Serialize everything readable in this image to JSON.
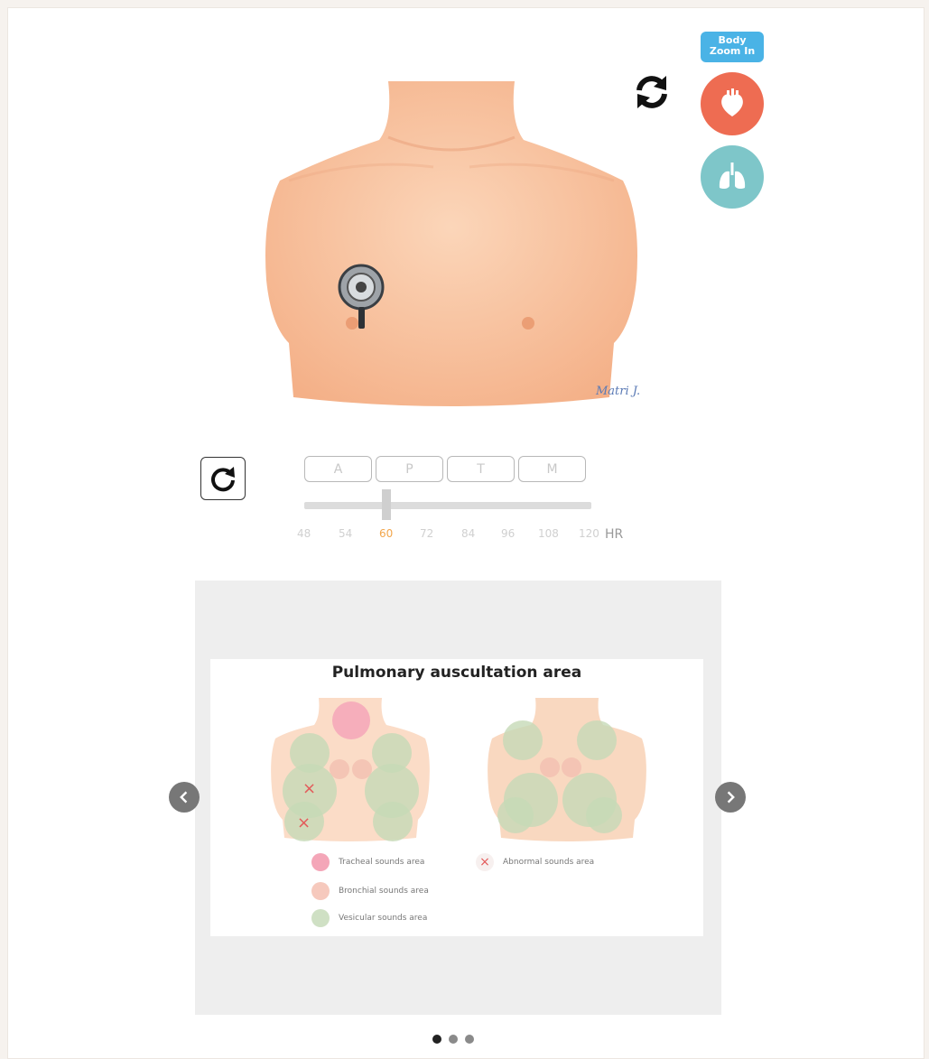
{
  "controls": {
    "zoom_label_line1": "Body",
    "zoom_label_line2": "Zoom In",
    "swap_icon": "swap-refresh-icon",
    "heart_icon": "heart-icon",
    "lung_icon": "lungs-icon",
    "reset_icon": "rotate-icon"
  },
  "illustration": {
    "signature": "Matri J."
  },
  "auscultation_buttons": [
    "A",
    "P",
    "T",
    "M"
  ],
  "heart_rate": {
    "ticks": [
      "48",
      "54",
      "60",
      "72",
      "84",
      "96",
      "108",
      "120"
    ],
    "selected": "60",
    "unit": "HR"
  },
  "slide": {
    "title": "Pulmonary auscultation area",
    "legend": [
      {
        "label": "Tracheal sounds area",
        "color": "#f4a6b8"
      },
      {
        "label": "Bronchial sounds area",
        "color": "#f6c9bd"
      },
      {
        "label": "Vesicular sounds area",
        "color": "#cfe0c4"
      },
      {
        "label": "Abnormal sounds area",
        "color": "#e35a5a"
      }
    ],
    "abnormal_mark": "×"
  },
  "carousel": {
    "prev_icon": "chevron-left-icon",
    "next_icon": "chevron-right-icon",
    "page_count": 3,
    "current_page": 1
  },
  "colors": {
    "heart_button": "#ee6c52",
    "lung_button": "#7ec6c9",
    "zoom_badge": "#4ab3e6",
    "active_tick": "#f2a64c"
  }
}
